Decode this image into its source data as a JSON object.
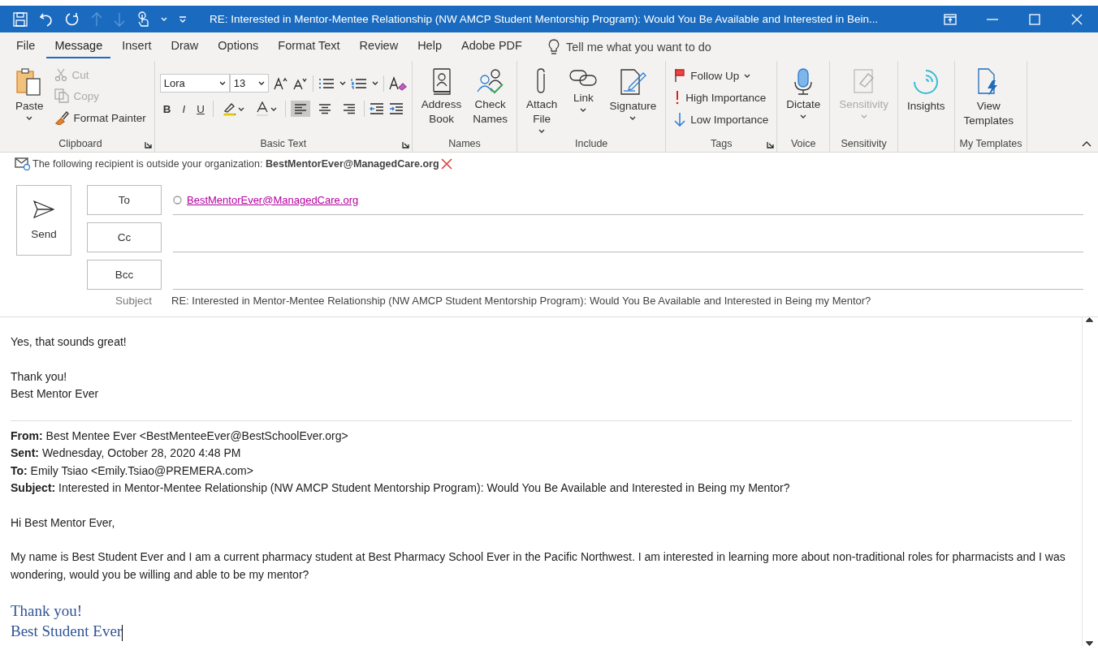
{
  "title_bar": {
    "title": "RE: Interested in Mentor-Mentee Relationship (NW AMCP Student Mentorship Program): Would You Be Available and Interested in Bein..."
  },
  "menu_tabs": [
    {
      "label": "File",
      "selected": false
    },
    {
      "label": "Message",
      "selected": true
    },
    {
      "label": "Insert",
      "selected": false
    },
    {
      "label": "Draw",
      "selected": false
    },
    {
      "label": "Options",
      "selected": false
    },
    {
      "label": "Format Text",
      "selected": false
    },
    {
      "label": "Review",
      "selected": false
    },
    {
      "label": "Help",
      "selected": false
    },
    {
      "label": "Adobe PDF",
      "selected": false
    }
  ],
  "tell_me": {
    "placeholder": "Tell me what you want to do"
  },
  "ribbon": {
    "groups": [
      {
        "label": "Clipboard",
        "launcher": true,
        "items": [
          {
            "kind": "large",
            "label": "Paste",
            "dropdown": true,
            "disabled": false
          },
          {
            "kind": "small",
            "label": "Cut",
            "dropdown": false,
            "disabled": true
          },
          {
            "kind": "small",
            "label": "Copy",
            "dropdown": false,
            "disabled": true
          },
          {
            "kind": "small",
            "label": "Format Painter",
            "dropdown": false,
            "disabled": false
          }
        ]
      },
      {
        "label": "Basic Text",
        "launcher": true,
        "kind": "font",
        "font": "Lora",
        "size": "13",
        "format_buttons": [
          "B",
          "I",
          "U"
        ],
        "alignments": [
          {
            "selected": true
          },
          {
            "selected": false
          },
          {
            "selected": false
          }
        ]
      },
      {
        "label": "Names",
        "items": [
          {
            "kind": "large",
            "label": "Address\nBook",
            "dropdown": false,
            "disabled": false
          },
          {
            "kind": "large",
            "label": "Check\nNames",
            "dropdown": false,
            "disabled": false
          }
        ]
      },
      {
        "label": "Include",
        "items": [
          {
            "kind": "large",
            "label": "Attach\nFile",
            "dropdown": true,
            "disabled": false
          },
          {
            "kind": "large",
            "label": "Link",
            "dropdown": true,
            "disabled": false
          },
          {
            "kind": "large",
            "label": "Signature",
            "dropdown": true,
            "disabled": false
          }
        ]
      },
      {
        "label": "Tags",
        "launcher": true,
        "items": [
          {
            "kind": "small",
            "label": "Follow Up",
            "dropdown": true,
            "disabled": false
          },
          {
            "kind": "small",
            "label": "High Importance",
            "dropdown": false,
            "disabled": false
          },
          {
            "kind": "small",
            "label": "Low Importance",
            "dropdown": false,
            "disabled": false
          }
        ]
      },
      {
        "label": "Voice",
        "items": [
          {
            "kind": "large",
            "label": "Dictate",
            "dropdown": true,
            "disabled": false
          }
        ]
      },
      {
        "label": "Sensitivity",
        "items": [
          {
            "kind": "large",
            "label": "Sensitivity",
            "dropdown": true,
            "disabled": true
          }
        ]
      },
      {
        "items": [
          {
            "kind": "large",
            "label": "Insights",
            "dropdown": false,
            "disabled": false
          }
        ]
      },
      {
        "label": "My Templates",
        "items": [
          {
            "kind": "large",
            "label": "View\nTemplates",
            "dropdown": false,
            "disabled": false
          }
        ]
      }
    ]
  },
  "info_bar": {
    "text": "The following recipient is outside your organization:  **BestMentorEver@ManagedCare.org**"
  },
  "header": {
    "send": "Send",
    "fields": [
      {
        "label": "To",
        "recipient": "BestMentorEver@ManagedCare.org"
      },
      {
        "label": "Cc"
      },
      {
        "label": "Bcc"
      }
    ],
    "subject_label": "Subject",
    "subject": "RE: Interested in Mentor-Mentee Relationship (NW AMCP Student Mentorship Program): Would You Be Available and Interested in Being my Mentor?"
  },
  "body": {
    "reply": [
      [
        "Yes, that sounds great!"
      ],
      [
        "Thank you!",
        "Best Mentor Ever"
      ]
    ],
    "quoted_header": [
      "**From:** Best Mentee Ever <BestMenteeEver@BestSchoolEver.org>",
      "**Sent:** Wednesday, October 28, 2020 4:48 PM",
      "**To:** Emily Tsiao <Emily.Tsiao@PREMERA.com>",
      "**Subject:** Interested in Mentor-Mentee Relationship (NW AMCP Student Mentorship Program): Would You Be Available and Interested in Being my Mentor?"
    ],
    "quoted_paragraphs": [
      "Hi Best Mentor Ever,",
      "My name is Best Student Ever and I am a current pharmacy student at Best Pharmacy School Ever in the Pacific Northwest. I am interested in learning more about non-traditional roles for pharmacists and I was wondering, would you be willing and able to be my mentor?"
    ],
    "signature": [
      "Thank you!",
      "Best Student Ever"
    ]
  }
}
